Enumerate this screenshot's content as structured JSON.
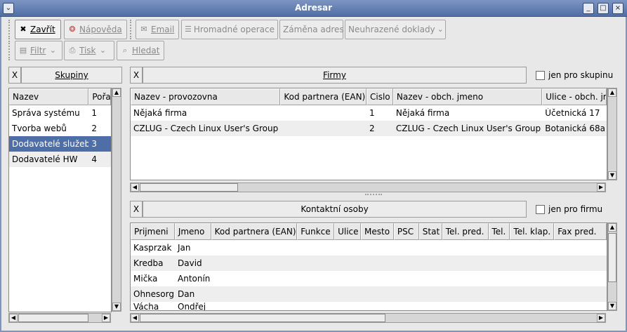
{
  "window": {
    "title": "Adresar"
  },
  "toolbar1": {
    "close": "Zavřít",
    "help": "Nápověda",
    "email": "Email",
    "bulk": "Hromadné operace",
    "swap": "Záměna adres",
    "unpaid": "Neuhrazené doklady"
  },
  "toolbar2": {
    "filter": "Filtr",
    "print": "Tisk",
    "search": "Hledat"
  },
  "groups": {
    "x": "X",
    "title": "Skupiny",
    "columns": [
      "Nazev",
      "Pořa"
    ],
    "rows": [
      {
        "name": "Správa systému",
        "order": "1"
      },
      {
        "name": "Tvorba webů",
        "order": "2"
      },
      {
        "name": "Dodavatelé služeb",
        "order": "3"
      },
      {
        "name": "Dodavatelé HW",
        "order": "4"
      }
    ]
  },
  "firms": {
    "x": "X",
    "title": "Firmy",
    "check_label": "jen pro skupinu",
    "columns": [
      "Nazev - provozovna",
      "Kod partnera (EAN)",
      "Cislo",
      "Nazev - obch. jmeno",
      "Ulice - obch. jr"
    ],
    "rows": [
      [
        "Nějaká firma",
        "",
        "1",
        "Nějaká firma",
        "Účetnická 17"
      ],
      [
        "CZLUG - Czech Linux User's Group",
        "",
        "2",
        "CZLUG - Czech Linux User's Group",
        "Botanická 68a"
      ]
    ]
  },
  "contacts": {
    "x": "X",
    "title": "Kontaktní osoby",
    "check_label": "jen pro firmu",
    "columns": [
      "Prijmeni",
      "Jmeno",
      "Kod partnera (EAN)",
      "Funkce",
      "Ulice",
      "Mesto",
      "PSC",
      "Stat",
      "Tel. pred.",
      "Tel.",
      "Tel. klap.",
      "Fax pred."
    ],
    "rows": [
      [
        "Kasprzak",
        "Jan"
      ],
      [
        "Kredba",
        "David"
      ],
      [
        "Mička",
        "Antonín"
      ],
      [
        "Ohnesorg",
        "Dan"
      ],
      [
        "Vácha",
        "Ondřej"
      ]
    ]
  },
  "colors": {
    "titlebar": "#506ea6",
    "selection": "#4e6ea8"
  }
}
